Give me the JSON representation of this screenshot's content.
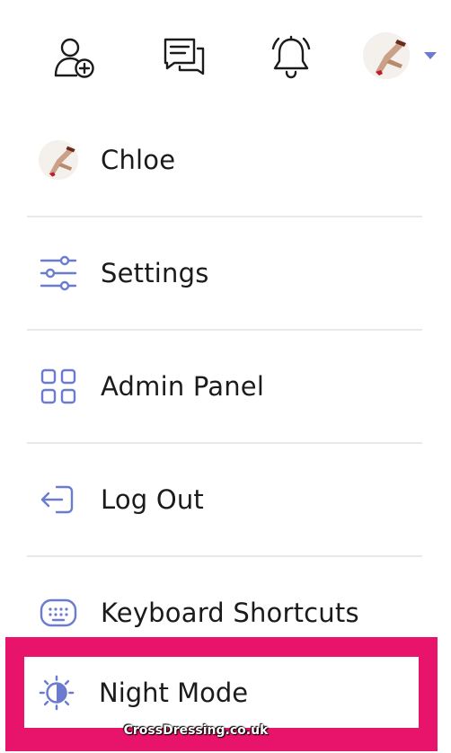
{
  "topbar": {
    "icons": [
      "add-friend-icon",
      "messages-icon",
      "notifications-icon"
    ],
    "accent_color": "#6b7bcf"
  },
  "menu": {
    "profile_name": "Chloe",
    "items": [
      {
        "label": "Settings",
        "icon": "sliders-icon"
      },
      {
        "label": "Admin Panel",
        "icon": "grid-icon"
      },
      {
        "label": "Log Out",
        "icon": "logout-icon"
      },
      {
        "label": "Keyboard Shortcuts",
        "icon": "keyboard-icon"
      },
      {
        "label": "Night Mode",
        "icon": "night-mode-icon"
      }
    ],
    "icon_color": "#6b7bcf"
  },
  "highlight_color": "#e8146c",
  "watermark": "CrossDressing.co.uk"
}
